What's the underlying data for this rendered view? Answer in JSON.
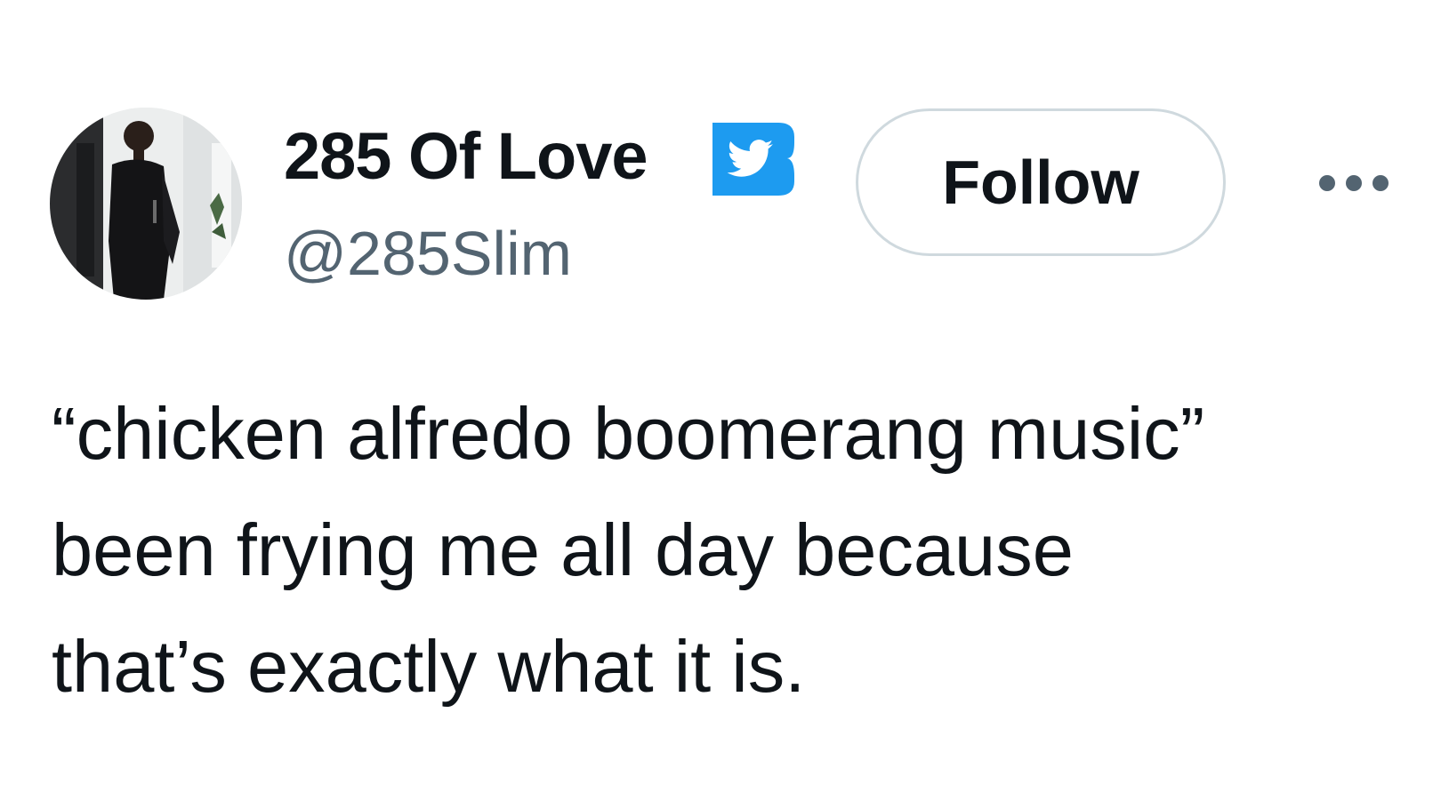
{
  "author": {
    "display_name": "285 Of Love",
    "handle": "@285Slim",
    "verified": true,
    "badge_color": "#1d9bf0"
  },
  "actions": {
    "follow_label": "Follow",
    "more_icon": "more-dots-icon"
  },
  "tweet": {
    "lines": [
      "“chicken alfredo boomerang music”",
      "been frying me all day because",
      "that’s exactly what it is."
    ]
  },
  "colors": {
    "text_primary": "#0f1419",
    "text_secondary": "#536471",
    "button_border": "#cfd9de"
  }
}
